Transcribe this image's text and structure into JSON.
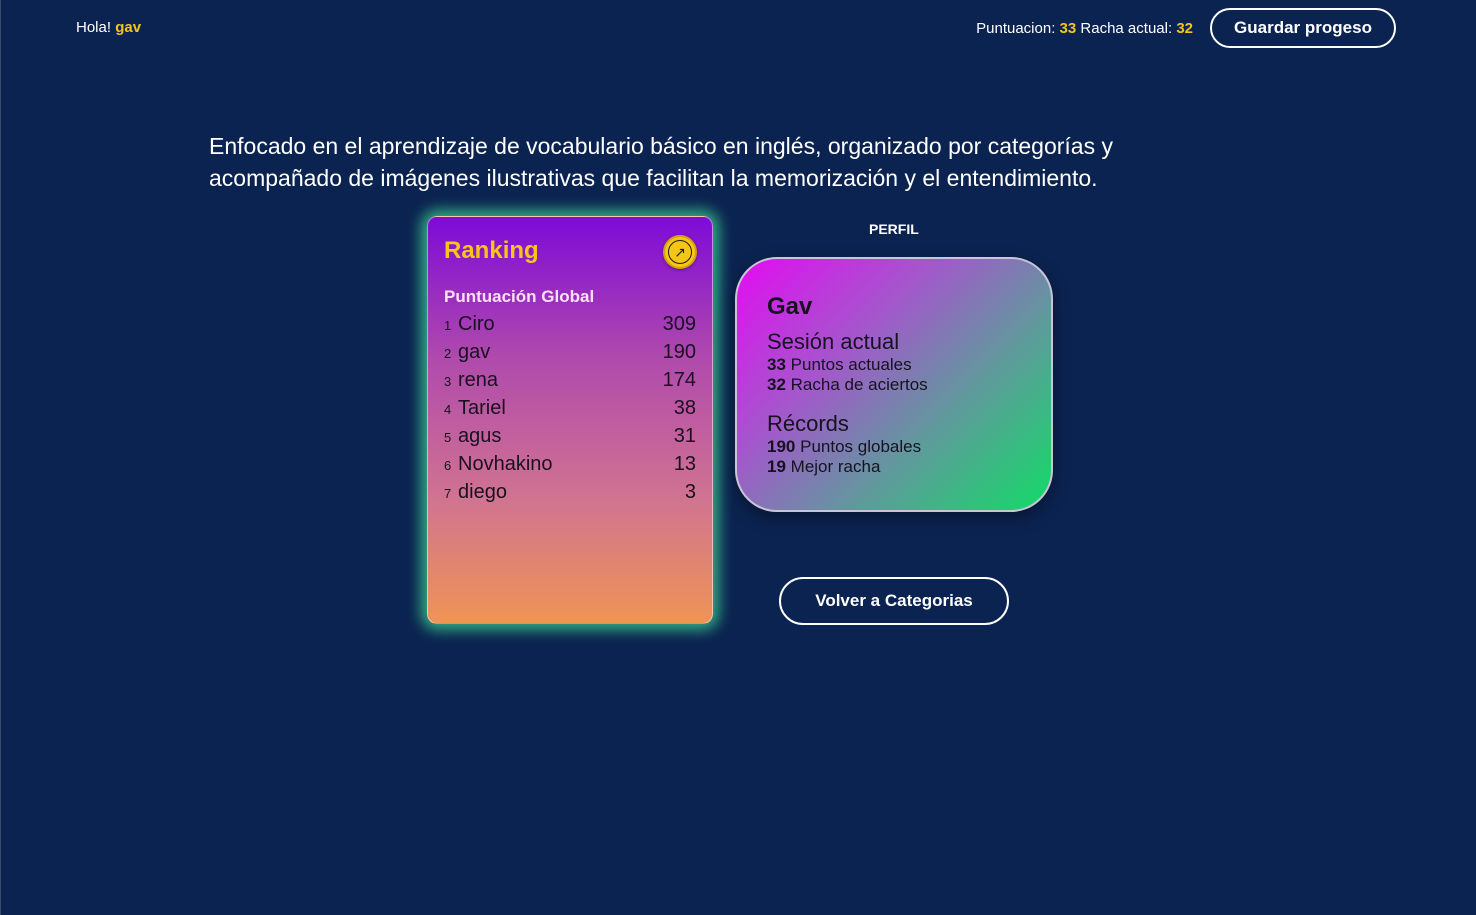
{
  "header": {
    "greeting_prefix": "Hola!",
    "username": "gav",
    "score_label": "Puntuacion:",
    "score_value": "33",
    "streak_label": "Racha actual:",
    "streak_value": "32",
    "save_label": "Guardar progeso"
  },
  "description": "Enfocado en el aprendizaje de vocabulario básico en inglés, organizado por categorías y acompañado de imágenes ilustrativas que facilitan la memorización y el entendimiento.",
  "ranking": {
    "title": "Ranking",
    "open_icon": "arrow-up-right-icon",
    "subtitle": "Puntuación Global",
    "rows": [
      {
        "pos": "1",
        "name": "Ciro",
        "points": "309"
      },
      {
        "pos": "2",
        "name": "gav",
        "points": "190"
      },
      {
        "pos": "3",
        "name": "rena",
        "points": "174"
      },
      {
        "pos": "4",
        "name": "Tariel",
        "points": "38"
      },
      {
        "pos": "5",
        "name": "agus",
        "points": "31"
      },
      {
        "pos": "6",
        "name": "Novhakino",
        "points": "13"
      },
      {
        "pos": "7",
        "name": "diego",
        "points": "3"
      }
    ]
  },
  "profile": {
    "label": "PERFIL",
    "name": "Gav",
    "session_title": "Sesión actual",
    "current_points_value": "33",
    "current_points_label": "Puntos actuales",
    "streak_value": "32",
    "streak_label": "Racha de aciertos",
    "records_title": "Récords",
    "global_points_value": "190",
    "global_points_label": "Puntos globales",
    "best_streak_value": "19",
    "best_streak_label": "Mejor racha"
  },
  "back_button_label": "Volver a Categorias",
  "colors": {
    "background": "#0b2350",
    "accent_yellow": "#f5c518",
    "glow_green": "#40dc96"
  }
}
